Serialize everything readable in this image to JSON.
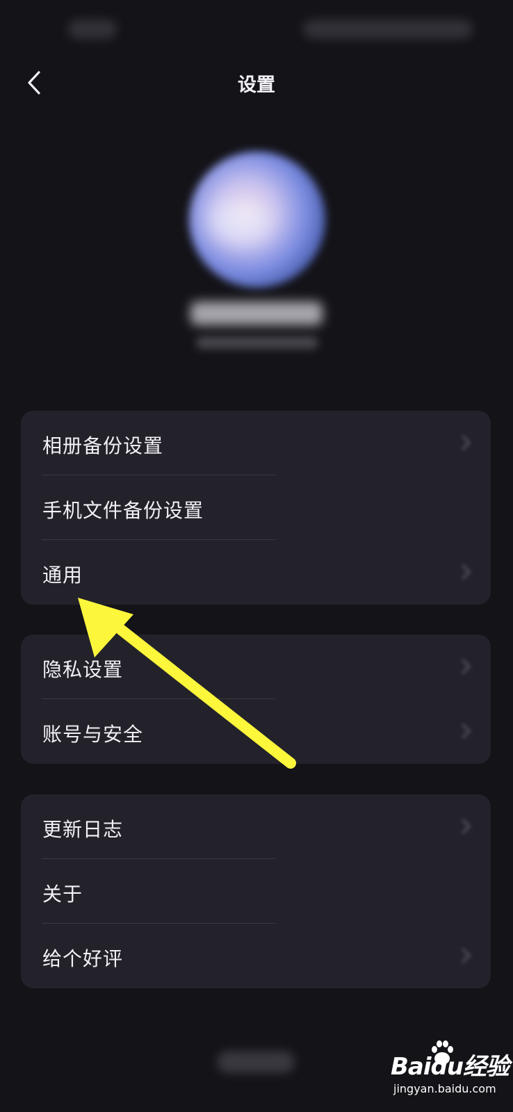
{
  "header": {
    "title": "设置",
    "back_icon": "chevron-left-icon"
  },
  "settings_groups": [
    {
      "items": [
        "相册备份设置",
        "手机文件备份设置",
        "通用"
      ]
    },
    {
      "items": [
        "隐私设置",
        "账号与安全"
      ]
    },
    {
      "items": [
        "更新日志",
        "关于",
        "给个好评"
      ]
    }
  ],
  "annotation": {
    "type": "arrow",
    "color": "#fdf73c",
    "points_to": "通用"
  },
  "watermark": {
    "brand": "Baidu经验",
    "site": "jingyan.baidu.com"
  },
  "colors": {
    "background": "#141318",
    "card": "#23222a",
    "text": "#f2f1f7",
    "divider": "#3b3a42"
  }
}
